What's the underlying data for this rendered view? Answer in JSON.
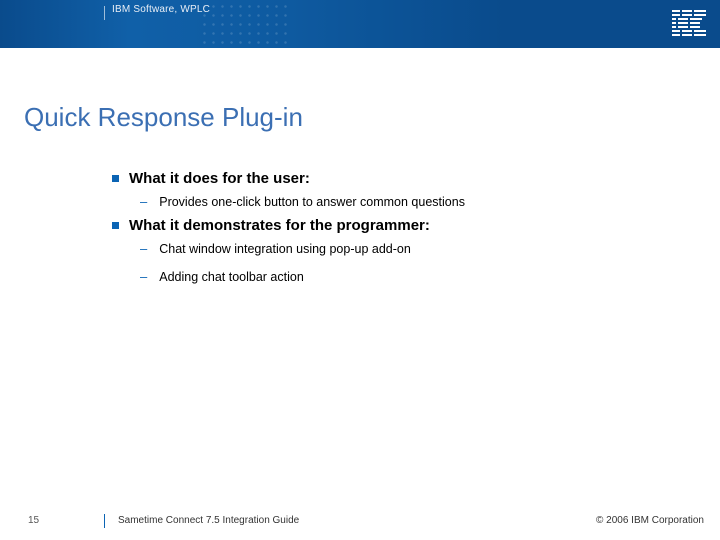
{
  "header": {
    "title": "IBM Software, WPLC",
    "logo_name": "IBM"
  },
  "slide": {
    "title": "Quick Response Plug-in"
  },
  "content": {
    "b0_heading": "What it does for the user:",
    "b0_items": {
      "0": "Provides one-click button to answer common questions"
    },
    "b1_heading": "What it demonstrates for the programmer:",
    "b1_items": {
      "0": "Chat window integration using pop-up add-on",
      "1": "Adding chat toolbar action"
    }
  },
  "footer": {
    "page": "15",
    "guide": "Sametime Connect 7.5 Integration Guide",
    "copyright": "© 2006 IBM Corporation"
  }
}
